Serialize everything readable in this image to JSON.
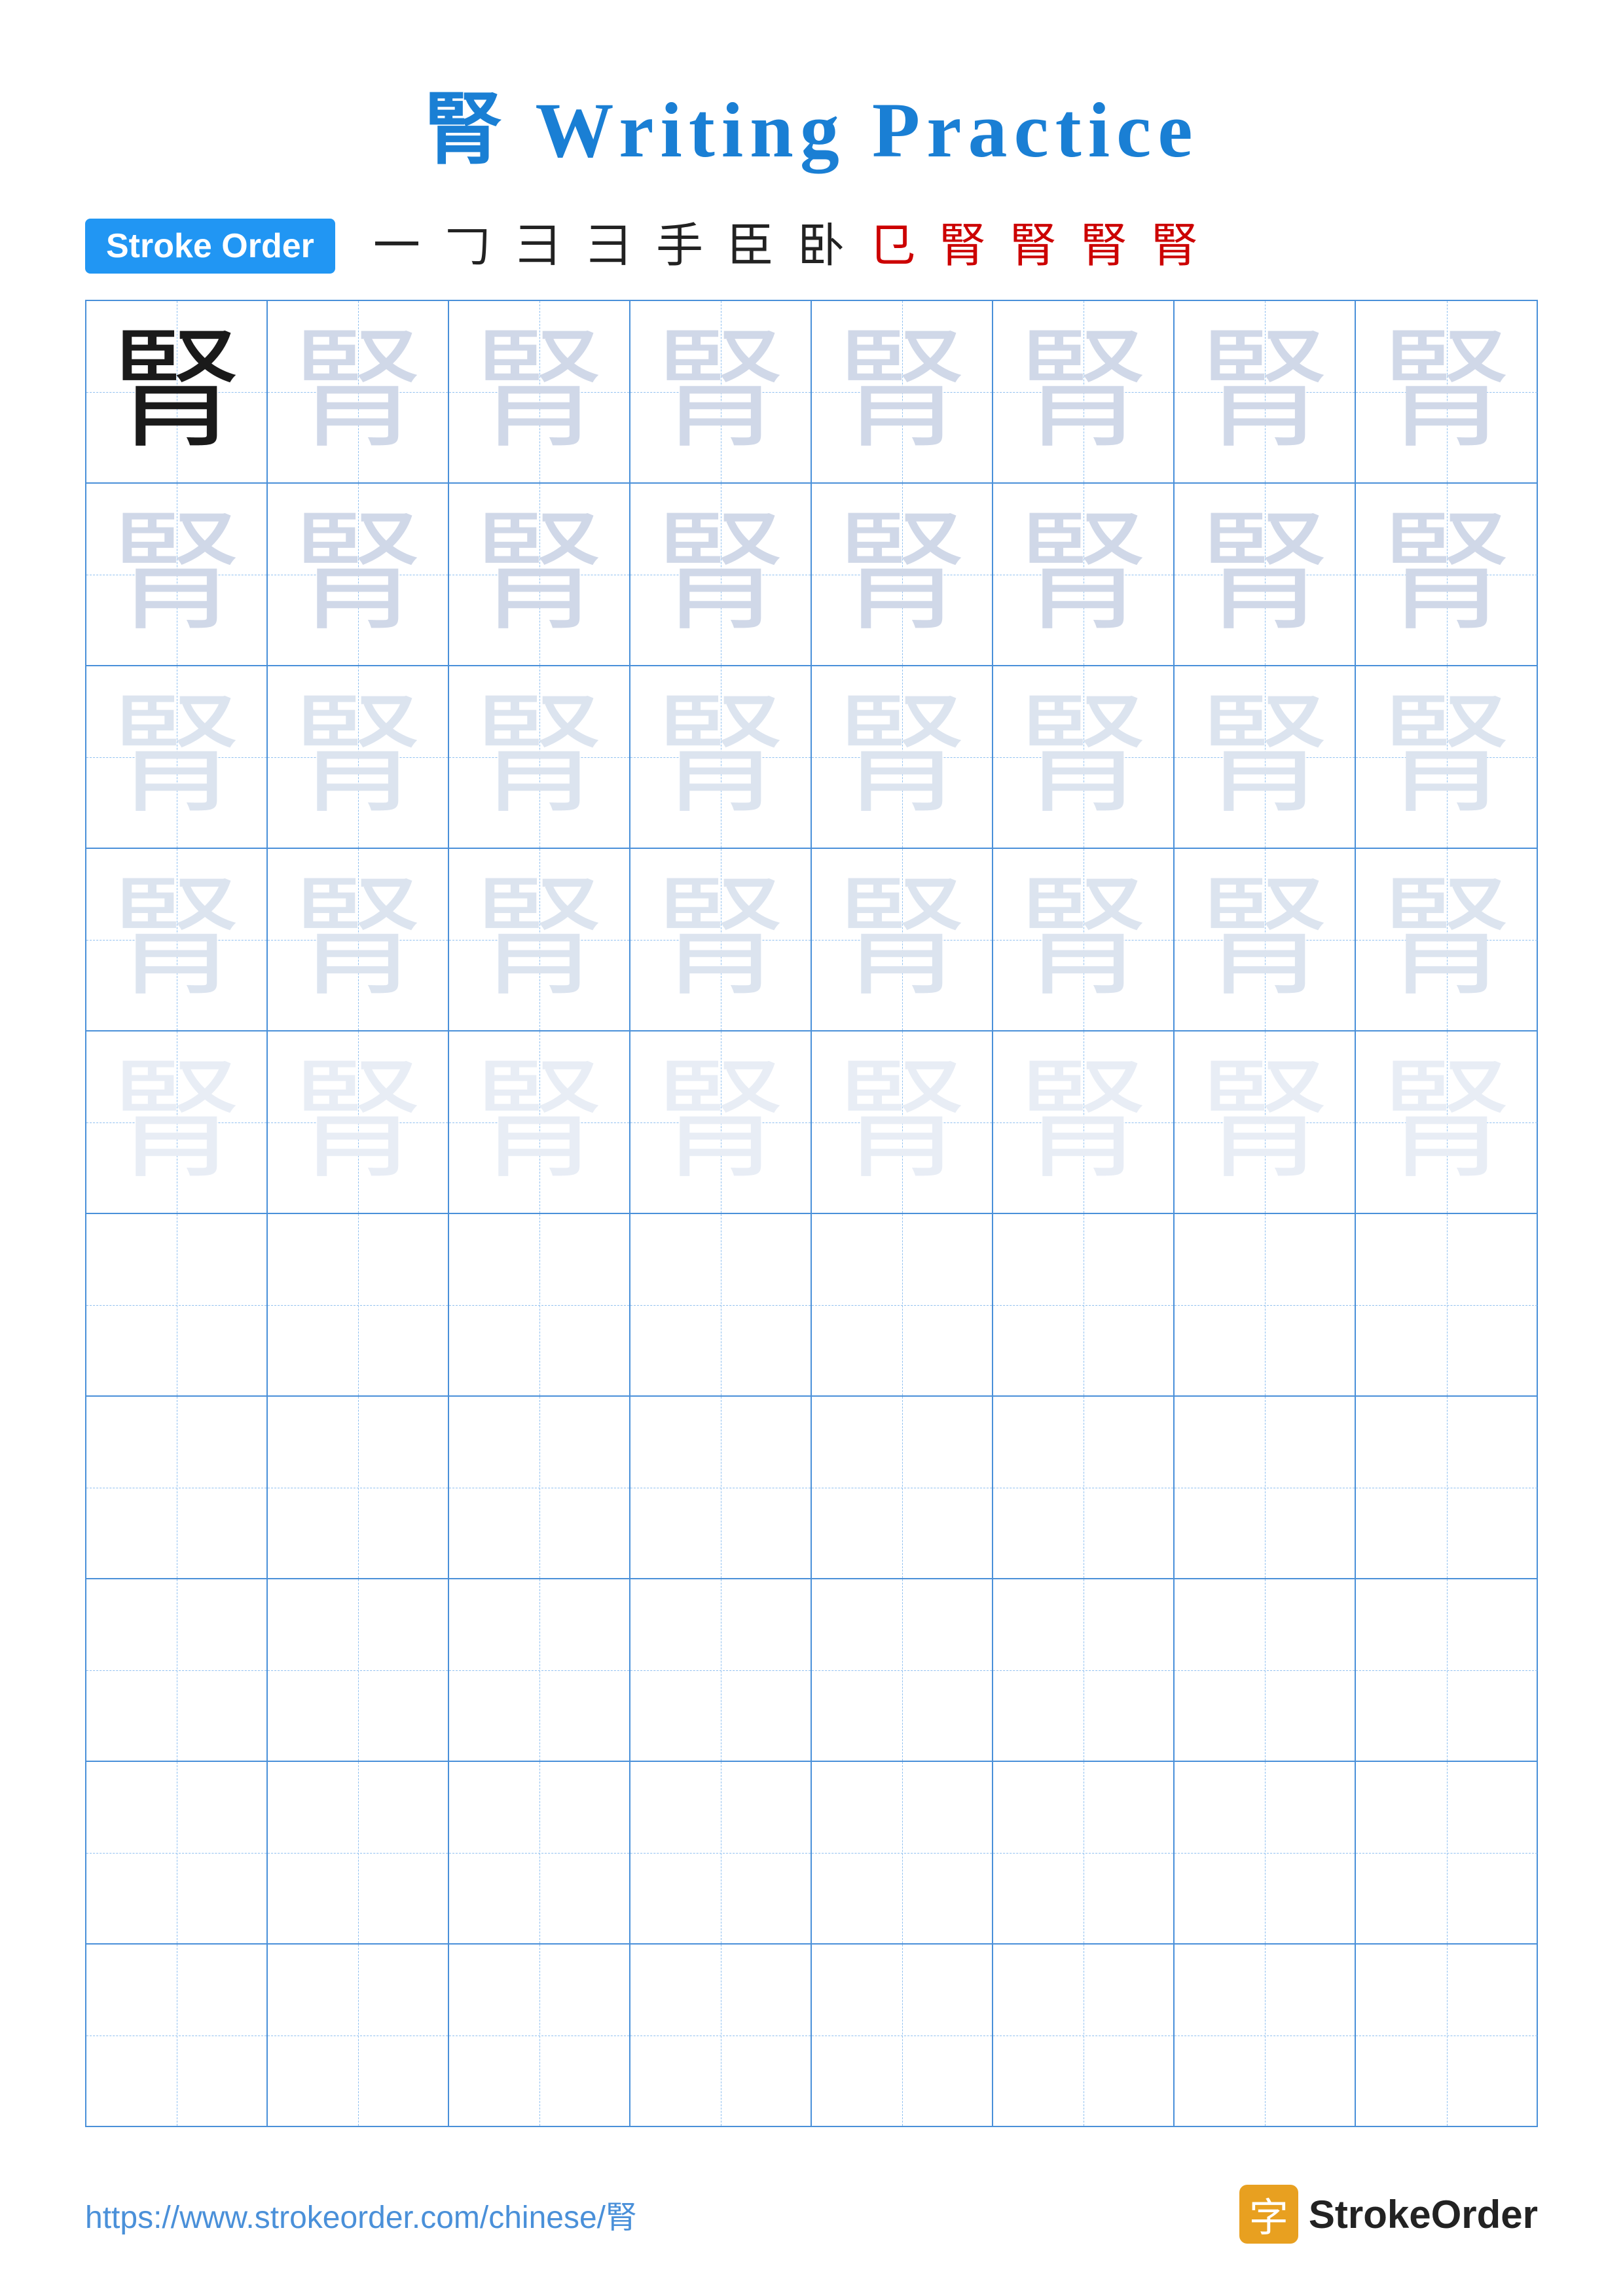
{
  "title": {
    "char": "腎",
    "subtitle": "Writing Practice"
  },
  "stroke_order": {
    "badge_label": "Stroke Order",
    "strokes": [
      "一",
      "𠃌",
      "彐",
      "彐",
      "手",
      "臣",
      "卧",
      "㔾",
      "竪",
      "腎",
      "腎",
      "腎"
    ]
  },
  "grid": {
    "rows": 10,
    "cols": 8,
    "character": "腎"
  },
  "footer": {
    "url": "https://www.strokeorder.com/chinese/腎",
    "brand_icon": "字",
    "brand_name": "StrokeOrder"
  }
}
